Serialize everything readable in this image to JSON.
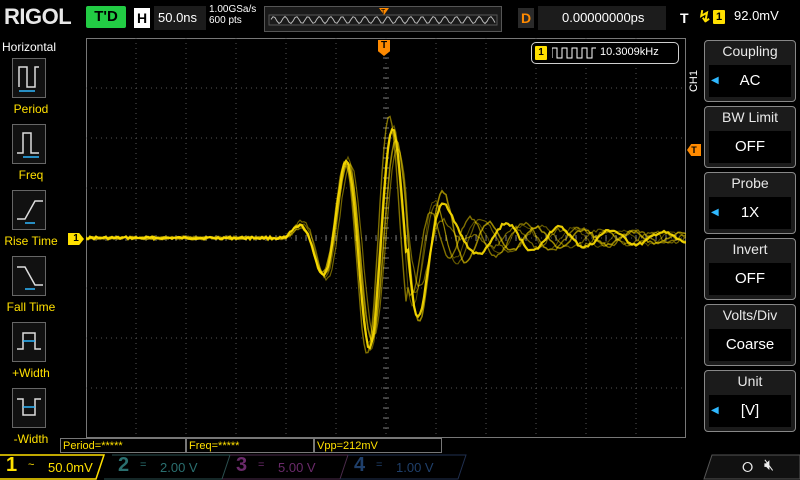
{
  "header": {
    "logo": "RIGOL",
    "run_state": "T'D",
    "horizontal_label": "H",
    "timebase": "50.0ns",
    "sample_rate": "1.00GSa/s",
    "memory_depth": "600 pts",
    "delay_label": "D",
    "delay_value": "0.00000000ps",
    "trigger_label": "T",
    "trigger_source": "1",
    "trigger_level": "92.0mV"
  },
  "left_menu": {
    "title": "Horizontal",
    "items": [
      {
        "label": "Period",
        "icon": "period-icon"
      },
      {
        "label": "Freq",
        "icon": "frequency-icon"
      },
      {
        "label": "Rise Time",
        "icon": "rise-time-icon"
      },
      {
        "label": "Fall Time",
        "icon": "fall-time-icon"
      },
      {
        "label": "+Width",
        "icon": "positive-width-icon"
      },
      {
        "label": "-Width",
        "icon": "negative-width-icon"
      }
    ]
  },
  "freq_badge": {
    "channel": "1",
    "value": "10.3009kHz"
  },
  "right_menu": {
    "channel_tag": "CH1",
    "items": [
      {
        "title": "Coupling",
        "value": "AC"
      },
      {
        "title": "BW Limit",
        "value": "OFF"
      },
      {
        "title": "Probe",
        "value": "1X"
      },
      {
        "title": "Invert",
        "value": "OFF"
      },
      {
        "title": "Volts/Div",
        "value": "Coarse"
      },
      {
        "title": "Unit",
        "value": "[V]"
      }
    ]
  },
  "measurements": {
    "period": "Period=*****",
    "freq": "Freq=*****",
    "vpp": "Vpp=212mV"
  },
  "channels": [
    {
      "num": "1",
      "scale": "50.0mV",
      "coupling": "~"
    },
    {
      "num": "2",
      "scale": "2.00 V",
      "coupling": "="
    },
    {
      "num": "3",
      "scale": "5.00 V",
      "coupling": "="
    },
    {
      "num": "4",
      "scale": "1.00 V",
      "coupling": "="
    }
  ],
  "markers": {
    "ch1_marker": "1",
    "trigger_marker": "T"
  },
  "colors": {
    "ch1": "#ffe000",
    "accent_trigger": "#ff8a00",
    "run_state": "#22cc44"
  }
}
